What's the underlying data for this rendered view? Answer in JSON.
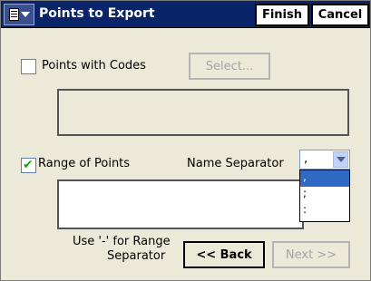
{
  "titlebar": {
    "title": "Points to Export",
    "finish_label": "Finish",
    "cancel_label": "Cancel",
    "menu_icon": "document-menu-icon"
  },
  "codes": {
    "label": "Points with Codes",
    "checked": false,
    "select_button": "Select...",
    "select_button_enabled": false,
    "codes_value": ""
  },
  "range": {
    "label": "Range of Points",
    "checked": true,
    "range_value": "",
    "hint_line1": "Use '-' for Range",
    "hint_line2": "Separator"
  },
  "separator": {
    "label": "Name Separator",
    "selected": ",",
    "options": [
      ",",
      ";",
      ":"
    ]
  },
  "nav": {
    "back_label": "<< Back",
    "next_label": "Next >>",
    "next_enabled": false
  },
  "colors": {
    "titlebar": "#0a246a",
    "window_bg": "#ece9d8",
    "check_green": "#21a121",
    "selection_blue": "#316ac5"
  }
}
